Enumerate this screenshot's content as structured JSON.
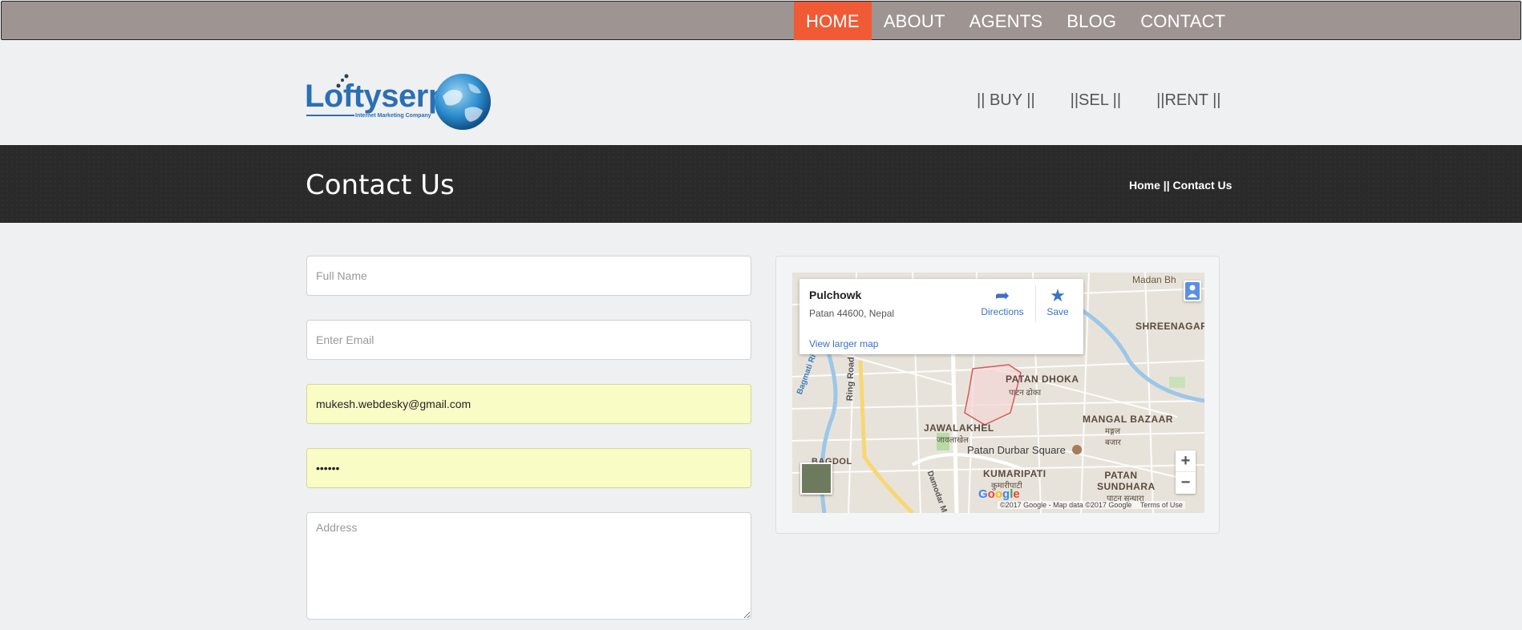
{
  "topnav": {
    "items": [
      {
        "label": "HOME",
        "active": true
      },
      {
        "label": "ABOUT",
        "active": false
      },
      {
        "label": "AGENTS",
        "active": false
      },
      {
        "label": "BLOG",
        "active": false
      },
      {
        "label": "CONTACT",
        "active": false
      }
    ],
    "active_color": "#f05a35",
    "bar_color": "#9e9593"
  },
  "logo": {
    "name": "Loftyserp",
    "tagline": "Internet Marketing Company"
  },
  "subnav": {
    "items": [
      "|| BUY ||",
      "||SEL ||",
      "||RENT ||"
    ]
  },
  "page_title": "Contact Us",
  "breadcrumb": {
    "home": "Home",
    "separator": " || ",
    "current": "Contact Us"
  },
  "form": {
    "full_name": {
      "placeholder": "Full Name",
      "value": ""
    },
    "email": {
      "placeholder": "Enter Email",
      "value": ""
    },
    "autofill_email": {
      "value": "mukesh.webdesky@gmail.com"
    },
    "password": {
      "value": "••••••"
    },
    "address": {
      "placeholder": "Address",
      "value": ""
    }
  },
  "map": {
    "place_name": "Pulchowk",
    "place_address": "Patan 44600, Nepal",
    "view_larger": "View larger map",
    "directions": "Directions",
    "save": "Save",
    "labels": {
      "madan": "Madan Bh",
      "shreenagar": "SHREENAGAR",
      "patan_dhoka": "PATAN DHOKA",
      "patan_dhoka_np": "पाटन ढोका",
      "jawalakhel": "JAWALAKHEL",
      "jawalakhel_np": "जावलाखेल",
      "mangal_bazaar": "MANGAL BAZAAR",
      "mangal_bazaar_np": "मङ्गल बजार",
      "patan_durbar": "Patan Durbar Square",
      "kumaripati": "KUMARIPATI",
      "kumaripati_np": "कुमारीपाटी",
      "patan_sundhara": "PATAN SUNDHARA",
      "patan_sundhara_np": "पाटन सुन्धारा",
      "bagmati": "Bagmati River",
      "ring_road": "Ring Road",
      "bagdol": "BAGDOL",
      "damodar": "Damodar M"
    },
    "zoom_in": "+",
    "zoom_out": "−",
    "google": "Google",
    "credit": "©2017 Google - Map data ©2017 Google",
    "terms": "Terms of Use"
  }
}
